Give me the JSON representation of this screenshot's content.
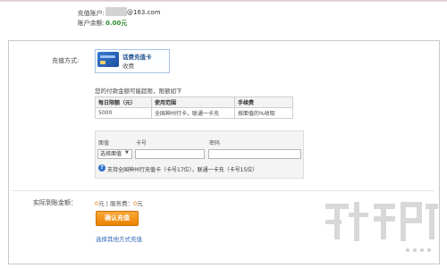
{
  "account": {
    "account_label": "充值账户:",
    "account_email": "@163.com",
    "balance_label": "账户余额:",
    "balance_value": "0.00元"
  },
  "method": {
    "label": "充值方式:",
    "card_name": "话费充值卡",
    "card_fee": "收费"
  },
  "limits": {
    "note": "您的付款金额可能超限，限额如下",
    "headers": [
      "每日限额（元）",
      "使用范围",
      "手续费"
    ],
    "row": [
      "5000",
      "全国神州行卡，联通一卡充",
      "按面值的%收取"
    ]
  },
  "form": {
    "denomination_label": "面值",
    "card_number_label": "卡号",
    "password_label": "密码",
    "select_value": "选择面值",
    "info_text": "支持全国神州行充值卡（卡号17位），联通一卡充（卡号15位）"
  },
  "summary": {
    "label": "实际到账金额：",
    "amount": "0",
    "amount_unit": "元",
    "separator": " | 服务费：",
    "fee": "0",
    "fee_unit": "元"
  },
  "actions": {
    "confirm_label": "确认充值",
    "other_method_link": "选择其他方式充值"
  },
  "colors": {
    "accent_orange": "#ec8300",
    "link_blue": "#2f66b7",
    "balance_green": "#2e8b2e"
  }
}
